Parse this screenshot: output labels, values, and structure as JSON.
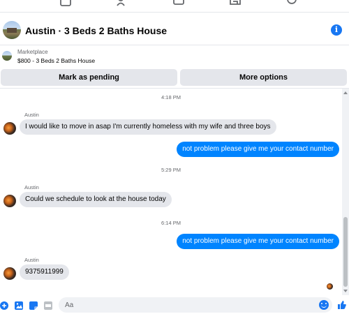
{
  "nav": {
    "icons": [
      "home-icon",
      "friends-icon",
      "watch-icon",
      "marketplace-icon",
      "groups-icon"
    ]
  },
  "header": {
    "title": "Austin · 3 Beds 2 Baths House",
    "info_icon": "info-icon"
  },
  "listing": {
    "source": "Marketplace",
    "description": "$800 - 3 Beds 2 Baths House"
  },
  "actions": {
    "mark_pending": "Mark as pending",
    "more_options": "More options"
  },
  "messages": {
    "ts1": "4:18 PM",
    "m1_sender": "Austin",
    "m1_text": "I would like to move in asap I'm currently homeless with my wife and three boys",
    "m2_text": "not problem please give me your contact number",
    "ts2": "5:29 PM",
    "m3_sender": "Austin",
    "m3_text": "Could we schedule to look at the house today",
    "ts3": "6:14 PM",
    "m4_text": "not problem please give me your contact number",
    "m5_sender": "Austin",
    "m5_text": "9375911999"
  },
  "composer": {
    "placeholder": "Aa",
    "icons": [
      "plus-icon",
      "image-icon",
      "sticker-icon",
      "gif-icon",
      "emoji-icon",
      "like-icon"
    ]
  },
  "colors": {
    "accent": "#0084ff",
    "brand": "#1877f2",
    "incoming_bubble": "#e4e6eb"
  }
}
